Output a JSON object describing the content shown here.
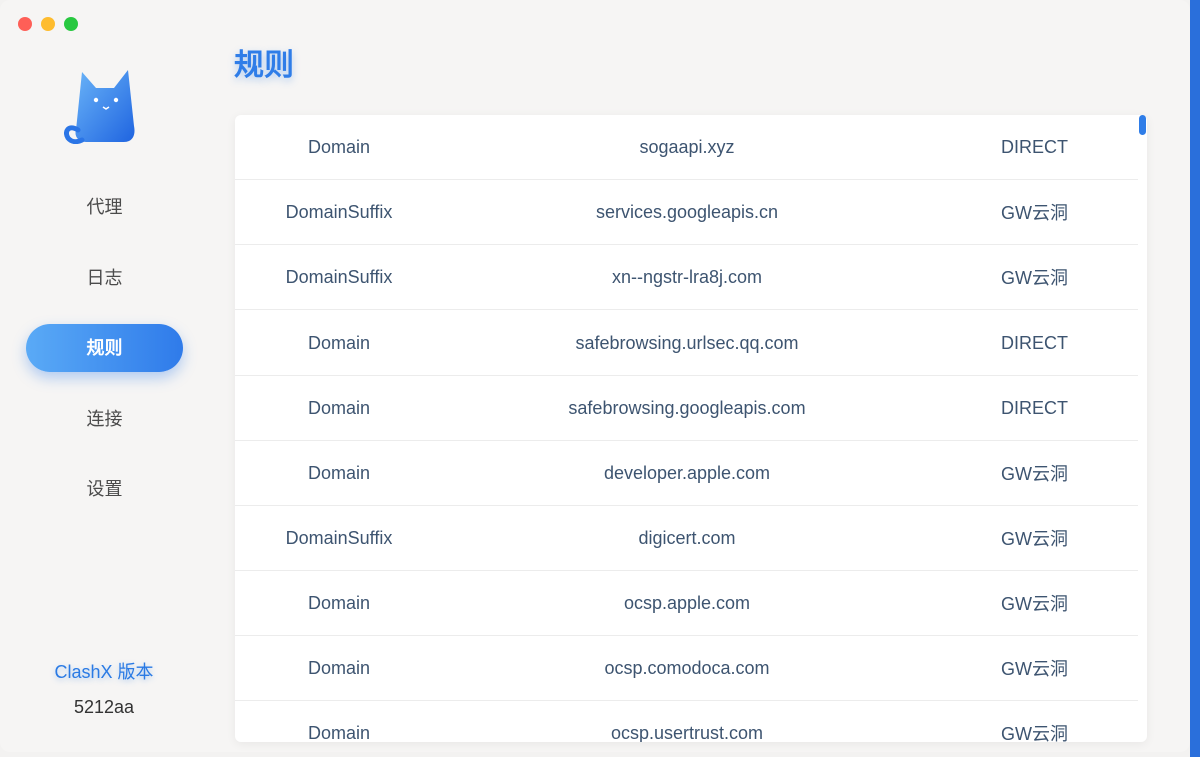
{
  "window": {
    "title": ""
  },
  "sidebar": {
    "logo": "clashx-cat-logo",
    "items": [
      {
        "label": "代理",
        "active": false
      },
      {
        "label": "日志",
        "active": false
      },
      {
        "label": "规则",
        "active": true
      },
      {
        "label": "连接",
        "active": false
      },
      {
        "label": "设置",
        "active": false
      }
    ],
    "version_label": "ClashX 版本",
    "version_value": "5212aa"
  },
  "main": {
    "title": "规则",
    "rules": [
      {
        "type": "Domain",
        "payload": "sogaapi.xyz",
        "target": "DIRECT"
      },
      {
        "type": "DomainSuffix",
        "payload": "services.googleapis.cn",
        "target": "GW云洞"
      },
      {
        "type": "DomainSuffix",
        "payload": "xn--ngstr-lra8j.com",
        "target": "GW云洞"
      },
      {
        "type": "Domain",
        "payload": "safebrowsing.urlsec.qq.com",
        "target": "DIRECT"
      },
      {
        "type": "Domain",
        "payload": "safebrowsing.googleapis.com",
        "target": "DIRECT"
      },
      {
        "type": "Domain",
        "payload": "developer.apple.com",
        "target": "GW云洞"
      },
      {
        "type": "DomainSuffix",
        "payload": "digicert.com",
        "target": "GW云洞"
      },
      {
        "type": "Domain",
        "payload": "ocsp.apple.com",
        "target": "GW云洞"
      },
      {
        "type": "Domain",
        "payload": "ocsp.comodoca.com",
        "target": "GW云洞"
      },
      {
        "type": "Domain",
        "payload": "ocsp.usertrust.com",
        "target": "GW云洞"
      }
    ]
  },
  "colors": {
    "accent": "#2f7de8",
    "sidebar_bg": "#f6f5f4",
    "row_text": "#3d5470"
  }
}
